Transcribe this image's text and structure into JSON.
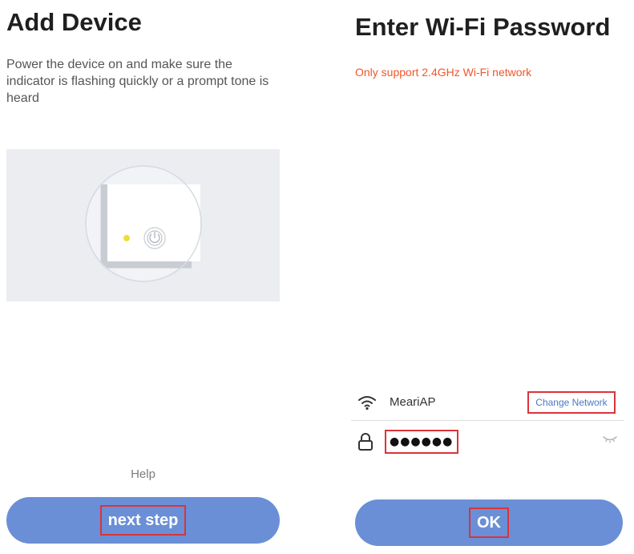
{
  "add_device": {
    "title": "Add Device",
    "description": "Power the device on and make sure the indicator is flashing quickly or a prompt tone is heard",
    "help_label": "Help",
    "next_button_label": "next step",
    "indicator_color": "#f2dc3c"
  },
  "wifi": {
    "title": "Enter Wi-Fi Password",
    "warning": "Only support 2.4GHz Wi-Fi network",
    "network_name": "MeariAP",
    "change_network_label": "Change Network",
    "password_value": "●●●●●●●●●",
    "ok_button_label": "OK"
  },
  "colors": {
    "accent": "#6b8fd6",
    "warning": "#f0562a",
    "link": "#4a78c6",
    "highlight_box": "#d9343a"
  }
}
